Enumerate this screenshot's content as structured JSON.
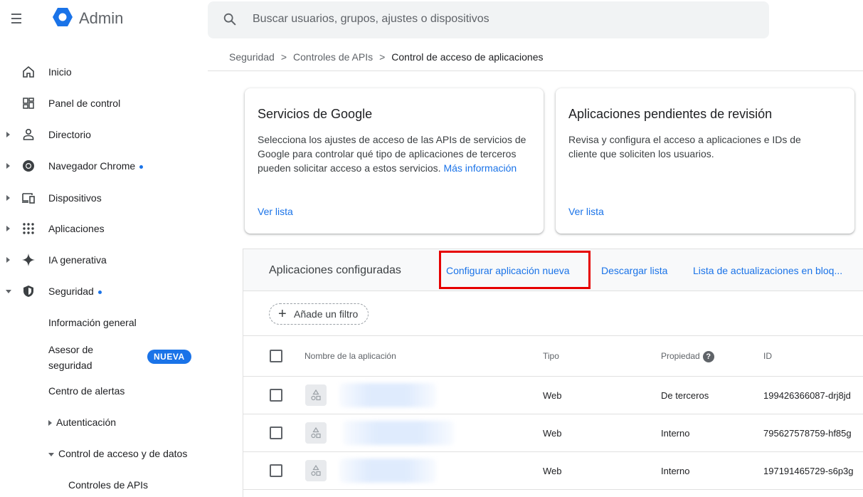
{
  "header": {
    "app_title": "Admin",
    "search_placeholder": "Buscar usuarios, grupos, ajustes o dispositivos"
  },
  "breadcrumb": {
    "items": [
      "Seguridad",
      "Controles de APIs"
    ],
    "separator": ">",
    "current": "Control de acceso de aplicaciones"
  },
  "sidebar": {
    "items": [
      {
        "label": "Inicio",
        "icon": "home-icon"
      },
      {
        "label": "Panel de control",
        "icon": "dashboard-icon"
      },
      {
        "label": "Directorio",
        "icon": "person-icon"
      },
      {
        "label": "Navegador Chrome",
        "icon": "chrome-icon"
      },
      {
        "label": "Dispositivos",
        "icon": "devices-icon"
      },
      {
        "label": "Aplicaciones",
        "icon": "apps-grid-icon"
      },
      {
        "label": "IA generativa",
        "icon": "sparkle-icon"
      },
      {
        "label": "Seguridad",
        "icon": "shield-icon"
      }
    ],
    "security_sub": {
      "overview": "Información general",
      "advisor_line1": "Asesor de",
      "advisor_line2": "seguridad",
      "advisor_badge": "NUEVA",
      "alert_center": "Centro de alertas",
      "authentication": "Autenticación",
      "access_data_control": "Control de acceso y de datos",
      "api_controls": "Controles de APIs"
    }
  },
  "cards": {
    "google_services": {
      "title": "Servicios de Google",
      "description": "Selecciona los ajustes de acceso de las APIs de servicios de Google para controlar qué tipo de aplicaciones de terceros pueden solicitar acceso a estos servicios.",
      "more_info": "Más información",
      "link": "Ver lista"
    },
    "pending_apps": {
      "title": "Aplicaciones pendientes de revisión",
      "description": "Revisa y configura el acceso a aplicaciones e IDs de cliente que soliciten los usuarios.",
      "link": "Ver lista"
    }
  },
  "configured": {
    "title": "Aplicaciones configuradas",
    "actions": {
      "configure_new": "Configurar aplicación nueva",
      "download_list": "Descargar lista",
      "bulk_updates": "Lista de actualizaciones en bloq..."
    },
    "filter_label": "Añade un filtro",
    "columns": {
      "name": "Nombre de la aplicación",
      "type": "Tipo",
      "ownership": "Propiedad",
      "id": "ID"
    },
    "rows": [
      {
        "type": "Web",
        "ownership": "De terceros",
        "id": "199426366087-drj8jd"
      },
      {
        "type": "Web",
        "ownership": "Interno",
        "id": "795627578759-hf85g"
      },
      {
        "type": "Web",
        "ownership": "Interno",
        "id": "197191465729-s6p3g"
      }
    ]
  },
  "colors": {
    "accent": "#1a73e8",
    "highlight_box": "#e60000"
  }
}
